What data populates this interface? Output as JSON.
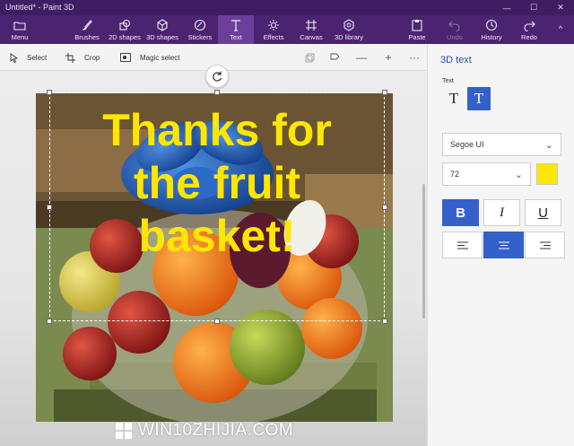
{
  "window": {
    "title": "Untitled* - Paint 3D",
    "controls": {
      "minimize": "—",
      "maximize": "☐",
      "close": "✕"
    }
  },
  "ribbon": {
    "menu_label": "Menu",
    "tools": [
      {
        "label": "Brushes",
        "icon": "brush-icon"
      },
      {
        "label": "2D shapes",
        "icon": "2d-shapes-icon"
      },
      {
        "label": "3D shapes",
        "icon": "3d-shapes-icon"
      },
      {
        "label": "Stickers",
        "icon": "stickers-icon"
      },
      {
        "label": "Text",
        "icon": "text-icon",
        "active": true
      },
      {
        "label": "Effects",
        "icon": "effects-icon"
      },
      {
        "label": "Canvas",
        "icon": "canvas-icon"
      },
      {
        "label": "3D library",
        "icon": "3d-library-icon"
      }
    ],
    "actions": [
      {
        "label": "Paste",
        "icon": "paste-icon"
      },
      {
        "label": "Undo",
        "icon": "undo-icon",
        "disabled": true
      },
      {
        "label": "History",
        "icon": "history-icon"
      },
      {
        "label": "Redo",
        "icon": "redo-icon"
      }
    ],
    "collapse_glyph": "^"
  },
  "toolbar": {
    "select_label": "Select",
    "crop_label": "Crop",
    "magic_select_label": "Magic select",
    "zoom_out_glyph": "—",
    "zoom_in_glyph": "+",
    "more_glyph": "···"
  },
  "canvas": {
    "text_lines": [
      "Thanks for",
      "the fruit",
      "basket!"
    ],
    "text_color": "#ffe600"
  },
  "watermark": {
    "text": "WIN10ZHIJIA.COM"
  },
  "panel": {
    "title": "3D text",
    "section_label": "Text",
    "type_2d_glyph": "T",
    "type_3d_glyph": "T",
    "font_family": "Segoe UI",
    "font_size": "72",
    "color": "#ffe600",
    "bold_glyph": "B",
    "italic_glyph": "I",
    "underline_glyph": "U",
    "bold_on": true,
    "alignment": "center"
  },
  "colors": {
    "titlebar": "#3f1d63",
    "ribbon": "#4a2470",
    "ribbon_active": "#6a3f99",
    "accent": "#3461c9"
  }
}
